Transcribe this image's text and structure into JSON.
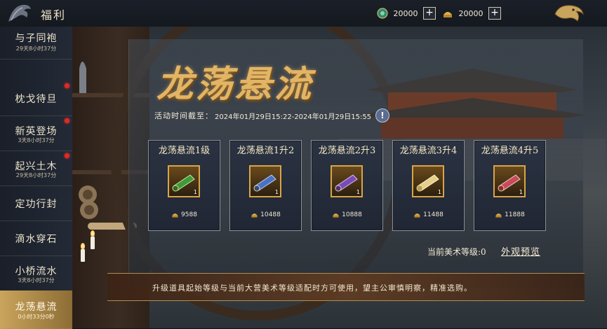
{
  "header": {
    "title": "福利",
    "currencies": [
      {
        "icon": "jade-coin-icon",
        "amount": "20000"
      },
      {
        "icon": "gold-ingot-icon",
        "amount": "20000"
      }
    ],
    "back_icon": "dragon-back-icon"
  },
  "sidebar": {
    "items": [
      {
        "label": "与子同袍",
        "timer": "29天8小时37分",
        "badge": false,
        "active": false
      },
      {
        "label": "枕戈待旦",
        "timer": "",
        "badge": true,
        "active": false
      },
      {
        "label": "新英登场",
        "timer": "3天8小时37分",
        "badge": true,
        "active": false
      },
      {
        "label": "起兴土木",
        "timer": "29天8小时37分",
        "badge": true,
        "active": false
      },
      {
        "label": "定功行封",
        "timer": "",
        "badge": false,
        "active": false
      },
      {
        "label": "滴水穿石",
        "timer": "",
        "badge": false,
        "active": false
      },
      {
        "label": "小桥流水",
        "timer": "3天8小时37分",
        "badge": false,
        "active": false
      },
      {
        "label": "龙荡悬流",
        "timer": "0小时33分0秒",
        "badge": false,
        "active": true
      }
    ]
  },
  "event": {
    "title": "龙荡悬流",
    "time_label": "活动时间截至：",
    "time_value": "2024年01月29日15:22-2024年01月29日15:55",
    "info_glyph": "!"
  },
  "cards": [
    {
      "title": "龙荡悬流1级",
      "scroll_color": "#3f9a3a",
      "count": "1",
      "cost": "9588"
    },
    {
      "title": "龙荡悬流1升2",
      "scroll_color": "#4a72c4",
      "count": "1",
      "cost": "10488"
    },
    {
      "title": "龙荡悬流2升3",
      "scroll_color": "#7a4ab8",
      "count": "1",
      "cost": "10888"
    },
    {
      "title": "龙荡悬流3升4",
      "scroll_color": "#e6cf8a",
      "count": "1",
      "cost": "11488"
    },
    {
      "title": "龙荡悬流4升5",
      "scroll_color": "#c94a5a",
      "count": "1",
      "cost": "11888"
    }
  ],
  "footer": {
    "art_level_label": "当前美术等级:0",
    "preview_label": "外观预览",
    "notice": "升级道具起始等级与当前大营美术等级适配时方可使用，望主公审慎明察，精准选购。"
  },
  "colors": {
    "accent_gold": "#d7a548",
    "badge_red": "#e02a1f",
    "active_tab": "#c9a45c"
  }
}
